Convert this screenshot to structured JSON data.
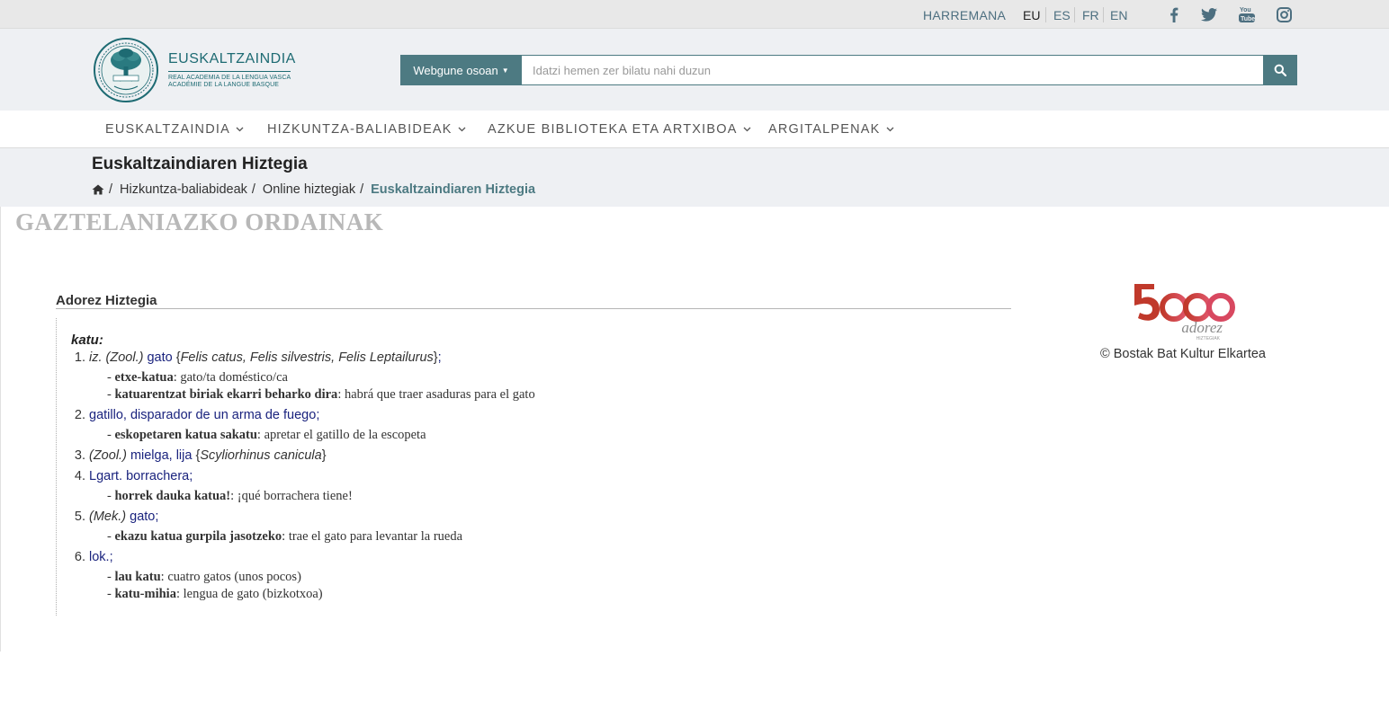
{
  "topbar": {
    "contact": "HARREMANA",
    "languages": [
      "EU",
      "ES",
      "FR",
      "EN"
    ],
    "active_language": "EU",
    "social_icons": [
      "facebook-icon",
      "twitter-icon",
      "youtube-icon",
      "instagram-icon"
    ]
  },
  "logo": {
    "name": "EUSKALTZAINDIA",
    "sub1": "REAL ACADEMIA DE LA LENGUA VASCA",
    "sub2": "ACADÉMIE DE LA LANGUE BASQUE"
  },
  "search": {
    "scope_label": "Webgune osoan",
    "placeholder": "Idatzi hemen zer bilatu nahi duzun"
  },
  "nav": {
    "items": [
      {
        "label": "EUSKALTZAINDIA"
      },
      {
        "label": "HIZKUNTZA-BALIABIDEAK"
      },
      {
        "label": "AZKUE BIBLIOTEKA ETA ARTXIBOA"
      },
      {
        "label": "ARGITALPENAK"
      }
    ]
  },
  "page": {
    "title": "Euskaltzaindiaren Hiztegia",
    "breadcrumb": [
      "Hizkuntza-baliabideak",
      "Online hiztegiak",
      "Euskaltzaindiaren Hiztegia"
    ]
  },
  "content": {
    "section_heading": "GAZTELANIAZKO ORDAINAK",
    "dictionary_title": "Adorez Hiztegia",
    "headword": "katu:",
    "senses": [
      {
        "num": "1.",
        "note": "iz. (Zool.)",
        "gloss": "gato",
        "sci": "Felis catus, Felis silvestris, Felis Leptailurus",
        "end": ";",
        "examples": [
          {
            "eu": "etxe-katua",
            "es": "gato/ta doméstico/ca"
          },
          {
            "eu": "katuarentzat biriak ekarri beharko dira",
            "es": "habrá que traer asaduras para el gato"
          }
        ]
      },
      {
        "num": "2.",
        "note": "",
        "gloss": "gatillo, disparador de un arma de fuego",
        "sci": "",
        "end": ";",
        "examples": [
          {
            "eu": "eskopetaren katua sakatu",
            "es": "apretar el gatillo de la escopeta"
          }
        ]
      },
      {
        "num": "3.",
        "note": "(Zool.)",
        "gloss": "mielga, lija",
        "sci": "Scyliorhinus canicula",
        "end": "",
        "examples": []
      },
      {
        "num": "4.",
        "note": "",
        "gloss": "Lgart. borrachera",
        "sci": "",
        "end": ";",
        "examples": [
          {
            "eu": "horrek dauka katua!",
            "es": "¡qué borrachera tiene!"
          }
        ]
      },
      {
        "num": "5.",
        "note": "(Mek.)",
        "gloss": "gato",
        "sci": "",
        "end": ";",
        "examples": [
          {
            "eu": "ekazu katua gurpila jasotzeko",
            "es": "trae el gato para levantar la rueda"
          }
        ]
      },
      {
        "num": "6.",
        "note": "",
        "gloss": "lok.",
        "sci": "",
        "end": ";",
        "examples": [
          {
            "eu": "lau katu",
            "es": "cuatro gatos (unos pocos)"
          },
          {
            "eu": "katu-mihia",
            "es": "lengua de gato (bizkotxoa)"
          }
        ]
      }
    ],
    "sponsor": {
      "logo_number": "5000",
      "logo_word": "adorez",
      "logo_small": "HIZTEGIAK",
      "caption": "© Bostak Bat Kultur Elkartea"
    }
  },
  "colors": {
    "accent": "#4d7a82",
    "brand": "#1e6b73",
    "gloss": "#1a237e",
    "heading_gray": "#b8b8b8",
    "sponsor_red": "#d3262b"
  }
}
